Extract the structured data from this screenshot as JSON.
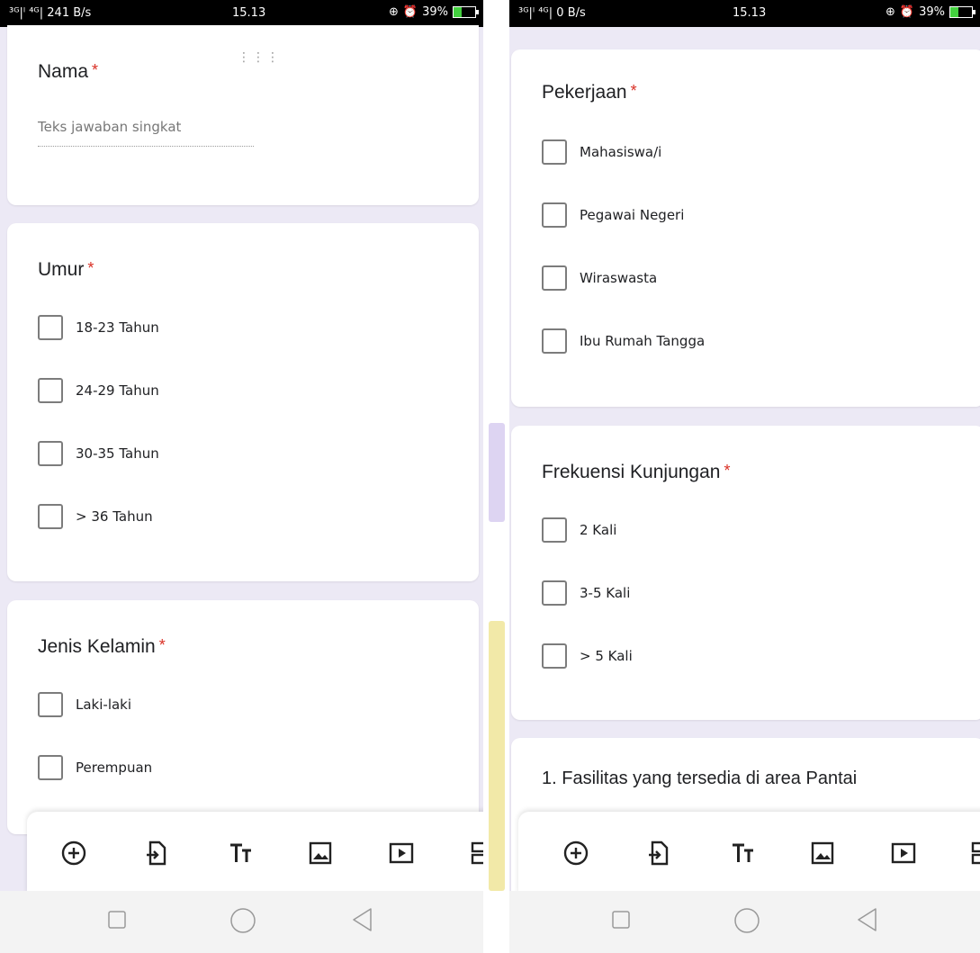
{
  "left": {
    "status": {
      "network": "³ᴳ|ˡ ⁴ᴳ| 241 B/s",
      "time": "15.13",
      "battery": "39%"
    },
    "nama": {
      "label": "Nama",
      "placeholder": "Teks jawaban singkat"
    },
    "umur": {
      "label": "Umur",
      "options": [
        "18-23 Tahun",
        "24-29 Tahun",
        "30-35 Tahun",
        "> 36 Tahun"
      ]
    },
    "jenis_kelamin": {
      "label": "Jenis Kelamin",
      "options": [
        "Laki-laki",
        "Perempuan"
      ]
    }
  },
  "right": {
    "status": {
      "network": "³ᴳ|ˡ ⁴ᴳ| 0 B/s",
      "time": "15.13",
      "battery": "39%"
    },
    "pekerjaan": {
      "label": "Pekerjaan",
      "options": [
        "Mahasiswa/i",
        "Pegawai Negeri",
        "Wiraswasta",
        "Ibu Rumah Tangga"
      ]
    },
    "frekuensi": {
      "label": "Frekuensi Kunjungan",
      "options": [
        "2 Kali",
        "3-5  Kali",
        "> 5 Kali"
      ]
    },
    "fasilitas": {
      "label": "1. Fasilitas yang tersedia di area Pantai"
    }
  },
  "required_marker": "*",
  "toolbar_icons": [
    "add-question-icon",
    "import-questions-icon",
    "add-title-icon",
    "add-image-icon",
    "add-video-icon",
    "add-section-icon"
  ],
  "nav_icons": [
    "recents-square-icon",
    "home-circle-icon",
    "back-triangle-icon"
  ],
  "colors": {
    "background": "#ece9f5",
    "card": "#ffffff",
    "required": "#d93025",
    "battery": "#43d13f",
    "checkbox_border": "#7c7c7c"
  }
}
